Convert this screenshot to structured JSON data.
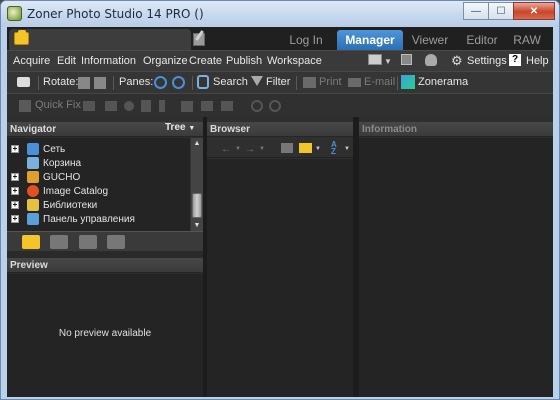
{
  "window": {
    "title": "Zoner Photo Studio 14 PRO  ()",
    "minimize": "—",
    "maximize": "☐",
    "close": "✕"
  },
  "tabs": [
    {
      "label": "Log In",
      "active": false
    },
    {
      "label": "Manager",
      "active": true
    },
    {
      "label": "Viewer",
      "active": false
    },
    {
      "label": "Editor",
      "active": false
    },
    {
      "label": "RAW",
      "active": false
    }
  ],
  "menu": {
    "items": [
      "Acquire",
      "Edit",
      "Information",
      "Organize",
      "Create",
      "Publish",
      "Workspace"
    ],
    "settings": "Settings",
    "help": "Help"
  },
  "toolbar1": {
    "rotate": "Rotate:",
    "panes": "Panes:",
    "search": "Search",
    "filter": "Filter",
    "print": "Print",
    "email": "E-mail",
    "zonerama": "Zonerama"
  },
  "toolbar2": {
    "quick_fix": "Quick Fix"
  },
  "navigator": {
    "title": "Navigator",
    "mode": "Tree",
    "items": [
      {
        "label": "Сеть",
        "expandable": true,
        "icon_color": "#4a90d8"
      },
      {
        "label": "Корзина",
        "expandable": false,
        "icon_color": "#7ab0e0"
      },
      {
        "label": "GUCHO",
        "expandable": true,
        "icon_color": "#e0a030"
      },
      {
        "label": "Image Catalog",
        "expandable": true,
        "icon_color": "#e05020"
      },
      {
        "label": "Библиотеки",
        "expandable": true,
        "icon_color": "#e8c040"
      },
      {
        "label": "Панель управления",
        "expandable": true,
        "icon_color": "#5aa0d8"
      }
    ]
  },
  "browser": {
    "title": "Browser"
  },
  "information": {
    "title": "Information"
  },
  "preview": {
    "title": "Preview",
    "empty_text": "No preview available"
  },
  "colors": {
    "accent": "#2c6fb4",
    "panel_bg": "#242424",
    "toolbar_bg": "#353535"
  }
}
